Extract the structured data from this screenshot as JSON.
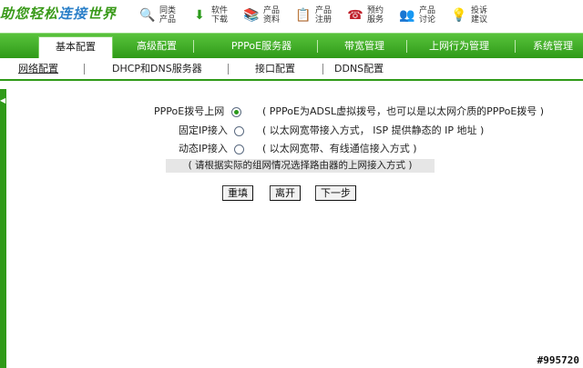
{
  "header": {
    "logo_text": "助您轻松",
    "logo_accent": "连接",
    "logo_tail": "世界",
    "quick_links": [
      {
        "icon": "search-icon",
        "glyph": "🔍",
        "label": "同类产品"
      },
      {
        "icon": "download-icon",
        "glyph": "⬇",
        "label": "软件下载"
      },
      {
        "icon": "book-icon",
        "glyph": "📚",
        "label": "产品资料"
      },
      {
        "icon": "register-icon",
        "glyph": "📋",
        "label": "产品注册"
      },
      {
        "icon": "phone-icon",
        "glyph": "☎",
        "label": "预约服务"
      },
      {
        "icon": "users-icon",
        "glyph": "👥",
        "label": "产品讨论"
      },
      {
        "icon": "feedback-icon",
        "glyph": "💡",
        "label": "投诉建议"
      }
    ]
  },
  "main_tabs": [
    {
      "label": "基本配置",
      "active": true
    },
    {
      "label": "高级配置",
      "active": false
    },
    {
      "label": "PPPoE服务器",
      "active": false
    },
    {
      "label": "带宽管理",
      "active": false
    },
    {
      "label": "上网行为管理",
      "active": false
    },
    {
      "label": "系统管理",
      "active": false
    }
  ],
  "sub_tabs": [
    {
      "label": "网络配置",
      "active": true
    },
    {
      "label": "DHCP和DNS服务器",
      "active": false
    },
    {
      "label": "接口配置",
      "active": false
    },
    {
      "label": "DDNS配置",
      "active": false
    }
  ],
  "form": {
    "options": [
      {
        "label": "PPPoE拨号上网",
        "desc": "( PPPoE为ADSL虚拟拨号，也可以是以太网介质的PPPoE拨号 )",
        "checked": true
      },
      {
        "label": "固定IP接入",
        "desc": "( 以太网宽带接入方式， ISP 提供静态的 IP 地址 )",
        "checked": false
      },
      {
        "label": "动态IP接入",
        "desc": "( 以太网宽带、有线通信接入方式 )",
        "checked": false
      }
    ],
    "hint": "( 请根据实际的组网情况选择路由器的上网接入方式 )",
    "buttons": {
      "reset": "重填",
      "leave": "离开",
      "next": "下一步"
    }
  },
  "watermark": "#995720",
  "colors": {
    "brand_green": "#2f9a18",
    "nav_green_light": "#58c33b"
  }
}
